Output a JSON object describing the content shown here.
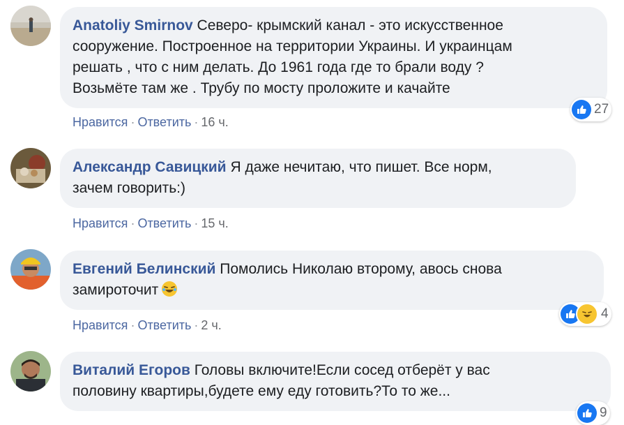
{
  "colors": {
    "bubble_bg": "#f0f2f5",
    "author_link": "#385898",
    "action_link": "#4b67a1",
    "like_blue": "#1877f2",
    "haha_yellow": "#f7c531"
  },
  "comments": [
    {
      "author": "Anatoliy Smirnov",
      "lines": [
        "Северо- крымский канал - это искусственное",
        "сооружение. Построенное на территории Украины. И украинцам",
        "решать , что с ним делать. До 1961 года где то брали воду ?",
        "Возьмёте там же . Трубу по мосту проложите и качайте"
      ],
      "like_label": "Нравится",
      "reply_label": "Ответить",
      "time": "16 ч.",
      "reactions": {
        "icons": [
          "like-icon"
        ],
        "count": "27"
      }
    },
    {
      "author": "Александр Савицкий",
      "lines": [
        "Я даже нечитаю, что пишет. Все норм,",
        "зачем говорить:)"
      ],
      "like_label": "Нравится",
      "reply_label": "Ответить",
      "time": "15 ч."
    },
    {
      "author": "Евгений Белинский",
      "lines": [
        "Помолись Николаю второму, авось снова",
        "замироточит"
      ],
      "emoji": "laughing-face-emoji",
      "like_label": "Нравится",
      "reply_label": "Ответить",
      "time": "2 ч.",
      "reactions": {
        "icons": [
          "like-icon",
          "haha-icon"
        ],
        "count": "4"
      }
    },
    {
      "author": "Виталий Егоров",
      "lines": [
        "Головы включите!Если сосед отберёт у вас",
        "половину квартиры,будете ему еду готовить?То то же..."
      ],
      "reactions": {
        "icons": [
          "like-icon"
        ],
        "count": "9"
      }
    }
  ]
}
